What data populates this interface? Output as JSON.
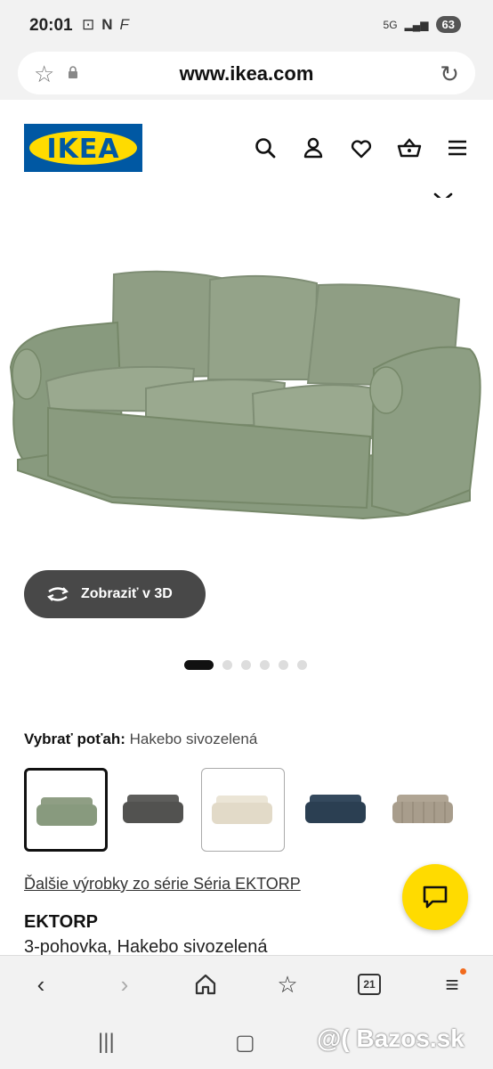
{
  "status_bar": {
    "time": "20:01",
    "network": "5G",
    "battery": "63"
  },
  "browser": {
    "url": "www.ikea.com"
  },
  "header": {
    "logo_text": "IKEA"
  },
  "hero": {
    "view3d_label": "Zobraziť v 3D",
    "carousel_pages": 6,
    "carousel_active": 1
  },
  "cover": {
    "label": "Vybrať poťah:",
    "value": "Hakebo sivozelená",
    "swatches": [
      {
        "color": "#8f9e84",
        "selected": true
      },
      {
        "color": "#585856",
        "selected": false
      },
      {
        "color": "#e8e1d1",
        "selected": false
      },
      {
        "color": "#2f4458",
        "selected": false
      },
      {
        "color": "#a89d8c",
        "selected": false
      }
    ]
  },
  "series_link": "Ďalšie výrobky zo série Séria EKTORP",
  "product": {
    "name": "EKTORP",
    "description": "3-pohovka, Hakebo sivozelená"
  },
  "bottom_nav": {
    "tab_count": "21"
  },
  "watermark": "@( Bazos.sk",
  "colors": {
    "ikea_blue": "#0058a3",
    "ikea_yellow": "#ffdb00",
    "sofa_green": "#8f9e84"
  }
}
